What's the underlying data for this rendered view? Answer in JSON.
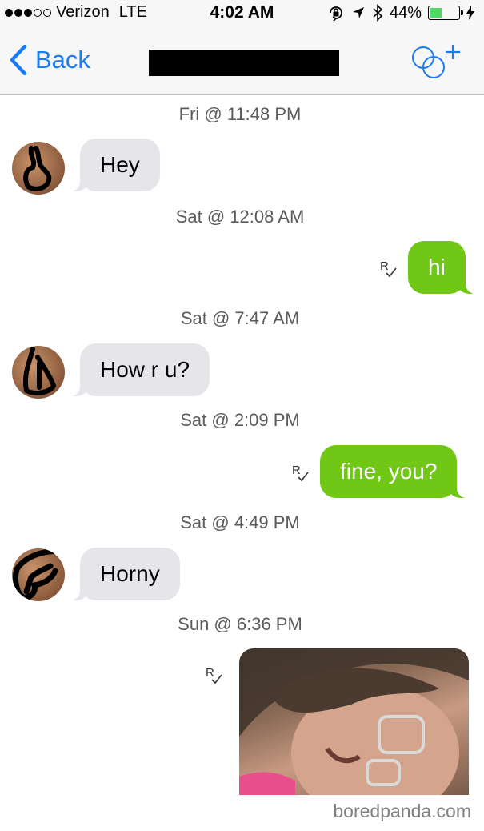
{
  "status_bar": {
    "carrier": "Verizon",
    "network": "LTE",
    "time": "4:02 AM",
    "battery": "44%",
    "battery_level": 0.44,
    "signal_bars": 3,
    "signal_total": 5
  },
  "nav": {
    "back_label": "Back",
    "title_redacted": true,
    "accent": "#1a7cf5"
  },
  "colors": {
    "incoming_bubble": "#e5e5ea",
    "outgoing_bubble": "#71c716",
    "timestamp": "#5a5a5f"
  },
  "messages": [
    {
      "timestamp": "Fri @ 11:48 PM",
      "direction": "incoming",
      "text": "Hey"
    },
    {
      "timestamp": "Sat @ 12:08 AM",
      "direction": "outgoing",
      "text": "hi",
      "receipt": "R"
    },
    {
      "timestamp": "Sat @ 7:47 AM",
      "direction": "incoming",
      "text": "How r u?"
    },
    {
      "timestamp": "Sat @ 2:09 PM",
      "direction": "outgoing",
      "text": "fine, you?",
      "receipt": "R"
    },
    {
      "timestamp": "Sat @ 4:49 PM",
      "direction": "incoming",
      "text": "Horny"
    },
    {
      "timestamp": "Sun @ 6:36 PM",
      "direction": "outgoing",
      "type": "photo",
      "receipt": "R"
    }
  ],
  "watermark": "boredpanda.com"
}
